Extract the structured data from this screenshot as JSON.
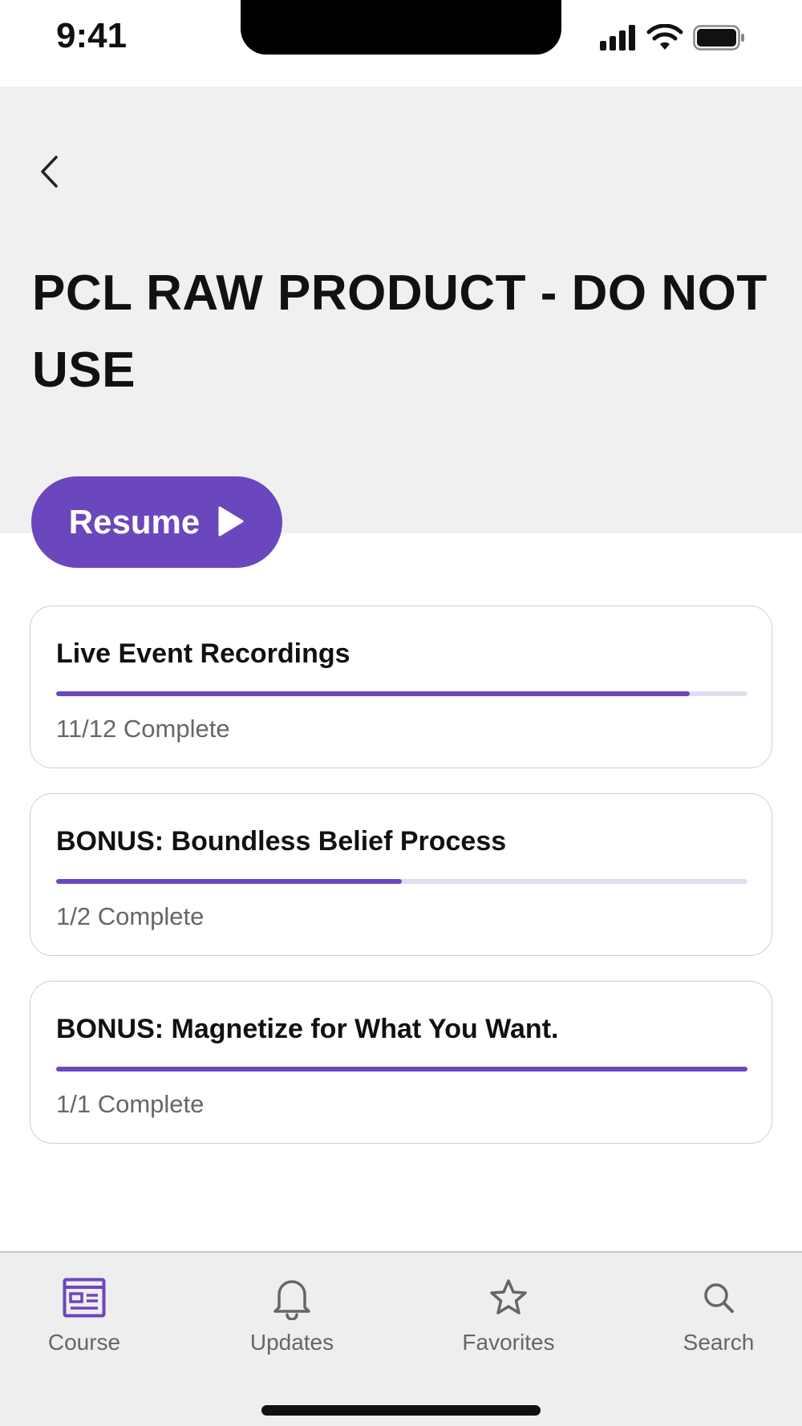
{
  "status_bar": {
    "time": "9:41"
  },
  "header": {
    "title": "PCL RAW PRODUCT - DO NOT USE"
  },
  "resume_button": {
    "label": "Resume"
  },
  "modules": [
    {
      "title": "Live Event Recordings",
      "status": "11/12 Complete",
      "progress": 0.917
    },
    {
      "title": "BONUS: Boundless Belief Process",
      "status": "1/2 Complete",
      "progress": 0.5
    },
    {
      "title": "BONUS: Magnetize for What You Want.",
      "status": "1/1 Complete",
      "progress": 1.0
    }
  ],
  "tab_bar": {
    "tabs": [
      {
        "label": "Course",
        "icon": "course-icon",
        "active": true
      },
      {
        "label": "Updates",
        "icon": "bell-icon",
        "active": false
      },
      {
        "label": "Favorites",
        "icon": "star-icon",
        "active": false
      },
      {
        "label": "Search",
        "icon": "search-icon",
        "active": false
      }
    ]
  },
  "colors": {
    "accent": "#6b47bd",
    "hero_bg": "#f0f0f0",
    "tab_bar_bg": "#eeeeee"
  }
}
